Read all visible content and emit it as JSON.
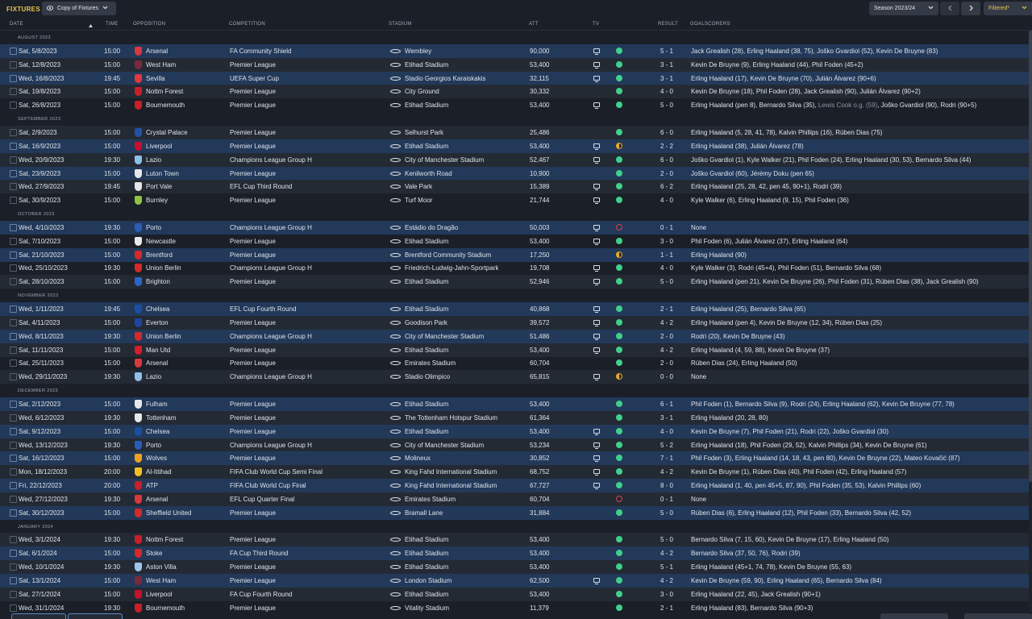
{
  "header": {
    "title": "FIXTURES",
    "view_label": "Copy of Fixtures",
    "season_label": "Season 2023/24",
    "filter_label": "Filtered*"
  },
  "columns": {
    "date": "DATE",
    "time": "TIME",
    "opposition": "OPPOSITION",
    "competition": "COMPETITION",
    "stadium": "STADIUM",
    "attendance": "ATT",
    "tv": "TV",
    "result": "RESULT",
    "goalscorers": "GOALSCORERS"
  },
  "rows": [
    {
      "month": "AUGUST 2023"
    },
    {
      "date": "Sat, 5/8/2023",
      "time": "15:00",
      "opp": "Arsenal",
      "crest": "#d8383e",
      "comp": "FA Community Shield",
      "stadium": "Wembley",
      "att": "90,000",
      "tv": true,
      "outcome": "win",
      "result": "5 - 1",
      "goals": "Jack Grealish (28), Erling Haaland (38, 75), Joško Gvardiol (52), Kevin De Bruyne (83)"
    },
    {
      "date": "Sat, 12/8/2023",
      "time": "15:00",
      "opp": "West Ham",
      "crest": "#7a2a3c",
      "comp": "Premier League",
      "stadium": "Etihad Stadium",
      "att": "53,400",
      "tv": true,
      "outcome": "win",
      "result": "3 - 1",
      "goals": "Kevin De Bruyne (9), Erling Haaland (44), Phil Foden (45+2)"
    },
    {
      "date": "Wed, 16/8/2023",
      "time": "19:45",
      "opp": "Sevilla",
      "crest": "#e03a3e",
      "comp": "UEFA Super Cup",
      "stadium": "Stadio Georgios Karaiskakis",
      "att": "32,115",
      "tv": true,
      "outcome": "win",
      "result": "3 - 1",
      "goals": "Erling Haaland (17), Kevin De Bruyne (70), Julián Álvarez (90+6)"
    },
    {
      "date": "Sat, 19/8/2023",
      "time": "15:00",
      "opp": "Nottm Forest",
      "crest": "#c8202a",
      "comp": "Premier League",
      "stadium": "City Ground",
      "att": "30,332",
      "tv": false,
      "outcome": "win",
      "result": "4 - 0",
      "goals": "Kevin De Bruyne (18), Phil Foden (28), Jack Grealish (90), Julián Álvarez (90+2)"
    },
    {
      "date": "Sat, 26/8/2023",
      "time": "15:00",
      "opp": "Bournemouth",
      "crest": "#c8202a",
      "comp": "Premier League",
      "stadium": "Etihad Stadium",
      "att": "53,400",
      "tv": true,
      "outcome": "win",
      "result": "5 - 0",
      "goals": "Erling Haaland (pen 8), Bernardo Silva (35), ",
      "og": "Lewis Cook o.g. (59)",
      "goals_after": ", Joško Gvardiol (90), Rodri (90+5)"
    },
    {
      "month": "SEPTEMBER 2023"
    },
    {
      "date": "Sat, 2/9/2023",
      "time": "15:00",
      "opp": "Crystal Palace",
      "crest": "#2350a8",
      "comp": "Premier League",
      "stadium": "Selhurst Park",
      "att": "25,486",
      "tv": false,
      "outcome": "win",
      "result": "6 - 0",
      "goals": "Erling Haaland (5, 28, 41, 78), Kalvin Phillips (16), Rúben Dias (75)"
    },
    {
      "date": "Sat, 16/9/2023",
      "time": "15:00",
      "opp": "Liverpool",
      "crest": "#c8102e",
      "comp": "Premier League",
      "stadium": "Etihad Stadium",
      "att": "53,400",
      "tv": true,
      "outcome": "draw",
      "result": "2 - 2",
      "goals": "Erling Haaland (38), Julián Álvarez (78)"
    },
    {
      "date": "Wed, 20/9/2023",
      "time": "19:30",
      "opp": "Lazio",
      "crest": "#8fc1e8",
      "comp": "Champions League Group H",
      "stadium": "City of Manchester Stadium",
      "att": "52,467",
      "tv": true,
      "outcome": "win",
      "result": "6 - 0",
      "goals": "Joško Gvardiol (1), Kyle Walker (21), Phil Foden (24), Erling Haaland (30, 53), Bernardo Silva (44)"
    },
    {
      "date": "Sat, 23/9/2023",
      "time": "15:00",
      "opp": "Luton Town",
      "crest": "#e8e8e8",
      "comp": "Premier League",
      "stadium": "Kenilworth Road",
      "att": "10,900",
      "tv": false,
      "outcome": "win",
      "result": "2 - 0",
      "goals": "Joško Gvardiol (60), Jérémy Doku (pen 65)"
    },
    {
      "date": "Wed, 27/9/2023",
      "time": "19:45",
      "opp": "Port Vale",
      "crest": "#e6e6e6",
      "comp": "EFL Cup Third Round",
      "stadium": "Vale Park",
      "att": "15,389",
      "tv": true,
      "outcome": "win",
      "result": "6 - 2",
      "goals": "Erling Haaland (25, 28, 42, pen 45, 90+1), Rodri (39)"
    },
    {
      "date": "Sat, 30/9/2023",
      "time": "15:00",
      "opp": "Burnley",
      "crest": "#8fc43f",
      "comp": "Premier League",
      "stadium": "Turf Moor",
      "att": "21,744",
      "tv": true,
      "outcome": "win",
      "result": "4 - 0",
      "goals": "Kyle Walker (6), Erling Haaland (9, 15), Phil Foden (36)"
    },
    {
      "month": "OCTOBER 2023"
    },
    {
      "date": "Wed, 4/10/2023",
      "time": "19:30",
      "opp": "Porto",
      "crest": "#2b5cb8",
      "comp": "Champions League Group H",
      "stadium": "Estádio do Dragão",
      "att": "50,003",
      "tv": true,
      "outcome": "loss",
      "result": "0 - 1",
      "goals": "None"
    },
    {
      "date": "Sat, 7/10/2023",
      "time": "15:00",
      "opp": "Newcastle",
      "crest": "#e8e8e8",
      "comp": "Premier League",
      "stadium": "Etihad Stadium",
      "att": "53,400",
      "tv": true,
      "outcome": "win",
      "result": "3 - 0",
      "goals": "Phil Foden (6), Julián Álvarez (37), Erling Haaland (64)"
    },
    {
      "date": "Sat, 21/10/2023",
      "time": "15:00",
      "opp": "Brentford",
      "crest": "#d42a2a",
      "comp": "Premier League",
      "stadium": "Brentford Community Stadium",
      "att": "17,250",
      "tv": false,
      "outcome": "draw",
      "result": "1 - 1",
      "goals": "Erling Haaland (90)"
    },
    {
      "date": "Wed, 25/10/2023",
      "time": "19:30",
      "opp": "Union Berlin",
      "crest": "#d42a2a",
      "comp": "Champions League Group H",
      "stadium": "Friedrich-Ludwig-Jahn-Sportpark",
      "att": "19,708",
      "tv": true,
      "outcome": "win",
      "result": "4 - 0",
      "goals": "Kyle Walker (3), Rodri (45+4), Phil Foden (51), Bernardo Silva (68)"
    },
    {
      "date": "Sat, 28/10/2023",
      "time": "15:00",
      "opp": "Brighton",
      "crest": "#2a67c4",
      "comp": "Premier League",
      "stadium": "Etihad Stadium",
      "att": "52,946",
      "tv": true,
      "outcome": "win",
      "result": "5 - 0",
      "goals": "Erling Haaland (pen 21), Kevin De Bruyne (26), Phil Foden (31), Rúben Dias (38), Jack Grealish (90)"
    },
    {
      "month": "NOVEMBER 2023"
    },
    {
      "date": "Wed, 1/11/2023",
      "time": "19:45",
      "opp": "Chelsea",
      "crest": "#1c4fa0",
      "comp": "EFL Cup Fourth Round",
      "stadium": "Etihad Stadium",
      "att": "40,868",
      "tv": true,
      "outcome": "win",
      "result": "2 - 1",
      "goals": "Erling Haaland (25), Bernardo Silva (65)"
    },
    {
      "date": "Sat, 4/11/2023",
      "time": "15:00",
      "opp": "Everton",
      "crest": "#1d46a0",
      "comp": "Premier League",
      "stadium": "Goodison Park",
      "att": "39,572",
      "tv": true,
      "outcome": "win",
      "result": "4 - 2",
      "goals": "Erling Haaland (pen 4), Kevin De Bruyne (12, 34), Rúben Dias (25)"
    },
    {
      "date": "Wed, 8/11/2023",
      "time": "19:30",
      "opp": "Union Berlin",
      "crest": "#d42a2a",
      "comp": "Champions League Group H",
      "stadium": "City of Manchester Stadium",
      "att": "51,486",
      "tv": true,
      "outcome": "win",
      "result": "2 - 0",
      "goals": "Rodri (20), Kevin De Bruyne (43)"
    },
    {
      "date": "Sat, 11/11/2023",
      "time": "15:00",
      "opp": "Man Utd",
      "crest": "#d41e2a",
      "comp": "Premier League",
      "stadium": "Etihad Stadium",
      "att": "53,400",
      "tv": true,
      "outcome": "win",
      "result": "4 - 2",
      "goals": "Erling Haaland (4, 59, 88), Kevin De Bruyne (37)"
    },
    {
      "date": "Sat, 25/11/2023",
      "time": "15:00",
      "opp": "Arsenal",
      "crest": "#d8383e",
      "comp": "Premier League",
      "stadium": "Emirates Stadium",
      "att": "60,704",
      "tv": false,
      "outcome": "win",
      "result": "2 - 0",
      "goals": "Rúben Dias (24), Erling Haaland (50)"
    },
    {
      "date": "Wed, 29/11/2023",
      "time": "19:30",
      "opp": "Lazio",
      "crest": "#8fc1e8",
      "comp": "Champions League Group H",
      "stadium": "Stadio Olimpico",
      "att": "65,815",
      "tv": true,
      "outcome": "draw",
      "result": "0 - 0",
      "goals": "None"
    },
    {
      "month": "DECEMBER 2023"
    },
    {
      "date": "Sat, 2/12/2023",
      "time": "15:00",
      "opp": "Fulham",
      "crest": "#e8e8e8",
      "comp": "Premier League",
      "stadium": "Etihad Stadium",
      "att": "53,400",
      "tv": false,
      "outcome": "win",
      "result": "6 - 1",
      "goals": "Phil Foden (1), Bernardo Silva (9), Rodri (24), Erling Haaland (62), Kevin De Bruyne (77, 78)"
    },
    {
      "date": "Wed, 6/12/2023",
      "time": "19:30",
      "opp": "Tottenham",
      "crest": "#e8e8e8",
      "comp": "Premier League",
      "stadium": "The Tottenham Hotspur Stadium",
      "att": "61,364",
      "tv": false,
      "outcome": "win",
      "result": "3 - 1",
      "goals": "Erling Haaland (20, 28, 80)"
    },
    {
      "date": "Sat, 9/12/2023",
      "time": "15:00",
      "opp": "Chelsea",
      "crest": "#1c4fa0",
      "comp": "Premier League",
      "stadium": "Etihad Stadium",
      "att": "53,400",
      "tv": true,
      "outcome": "win",
      "result": "4 - 0",
      "goals": "Kevin De Bruyne (7), Phil Foden (21), Rodri (22), Joško Gvardiol (30)"
    },
    {
      "date": "Wed, 13/12/2023",
      "time": "19:30",
      "opp": "Porto",
      "crest": "#2b5cb8",
      "comp": "Champions League Group H",
      "stadium": "City of Manchester Stadium",
      "att": "53,234",
      "tv": true,
      "outcome": "win",
      "result": "5 - 2",
      "goals": "Erling Haaland (18), Phil Foden (29, 52), Kalvin Phillips (34), Kevin De Bruyne (61)"
    },
    {
      "date": "Sat, 16/12/2023",
      "time": "15:00",
      "opp": "Wolves",
      "crest": "#f0a020",
      "comp": "Premier League",
      "stadium": "Molineux",
      "att": "30,852",
      "tv": true,
      "outcome": "win",
      "result": "7 - 1",
      "goals": "Phil Foden (3), Erling Haaland (14, 18, 43, pen 80), Kevin De Bruyne (22), Mateo Kovačić (87)"
    },
    {
      "date": "Mon, 18/12/2023",
      "time": "20:00",
      "opp": "Al-Ittihad",
      "crest": "#f0c020",
      "comp": "FIFA Club World Cup Semi Final",
      "stadium": "King Fahd International Stadium",
      "att": "68,752",
      "tv": true,
      "outcome": "win",
      "result": "4 - 2",
      "goals": "Kevin De Bruyne (1), Rúben Dias (40), Phil Foden (42), Erling Haaland (57)"
    },
    {
      "date": "Fri, 22/12/2023",
      "time": "20:00",
      "opp": "ATP",
      "crest": "#c8202a",
      "comp": "FIFA Club World Cup Final",
      "stadium": "King Fahd International Stadium",
      "att": "67,727",
      "tv": true,
      "outcome": "win",
      "result": "8 - 0",
      "goals": "Erling Haaland (1, 40, pen 45+5, 87, 90), Phil Foden (35, 53), Kalvin Phillips (60)"
    },
    {
      "date": "Wed, 27/12/2023",
      "time": "19:30",
      "opp": "Arsenal",
      "crest": "#d8383e",
      "comp": "EFL Cup Quarter Final",
      "stadium": "Emirates Stadium",
      "att": "60,704",
      "tv": false,
      "outcome": "loss",
      "result": "0 - 1",
      "goals": "None"
    },
    {
      "date": "Sat, 30/12/2023",
      "time": "15:00",
      "opp": "Sheffield United",
      "crest": "#d42a2a",
      "comp": "Premier League",
      "stadium": "Bramall Lane",
      "att": "31,884",
      "tv": false,
      "outcome": "win",
      "result": "5 - 0",
      "goals": "Rúben Dias (6), Erling Haaland (12), Phil Foden (33), Bernardo Silva (42, 52)"
    },
    {
      "month": "JANUARY 2024"
    },
    {
      "date": "Wed, 3/1/2024",
      "time": "19:30",
      "opp": "Nottm Forest",
      "crest": "#c8202a",
      "comp": "Premier League",
      "stadium": "Etihad Stadium",
      "att": "53,400",
      "tv": false,
      "outcome": "win",
      "result": "5 - 0",
      "goals": "Bernardo Silva (7, 15, 60), Kevin De Bruyne (17), Erling Haaland (50)"
    },
    {
      "date": "Sat, 6/1/2024",
      "time": "15:00",
      "opp": "Stoke",
      "crest": "#d42a2a",
      "comp": "FA Cup Third Round",
      "stadium": "Etihad Stadium",
      "att": "53,400",
      "tv": false,
      "outcome": "win",
      "result": "4 - 2",
      "goals": "Bernardo Silva (37, 50, 76), Rodri (39)"
    },
    {
      "date": "Wed, 10/1/2024",
      "time": "19:30",
      "opp": "Aston Villa",
      "crest": "#9ec6ea",
      "comp": "Premier League",
      "stadium": "Etihad Stadium",
      "att": "53,400",
      "tv": false,
      "outcome": "win",
      "result": "5 - 1",
      "goals": "Erling Haaland (45+1, 74, 78), Kevin De Bruyne (55, 63)"
    },
    {
      "date": "Sat, 13/1/2024",
      "time": "15:00",
      "opp": "West Ham",
      "crest": "#7a2a3c",
      "comp": "Premier League",
      "stadium": "London Stadium",
      "att": "62,500",
      "tv": true,
      "outcome": "win",
      "result": "4 - 2",
      "goals": "Kevin De Bruyne (59, 90), Erling Haaland (65), Bernardo Silva (84)"
    },
    {
      "date": "Sat, 27/1/2024",
      "time": "15:00",
      "opp": "Liverpool",
      "crest": "#c8102e",
      "comp": "FA Cup Fourth Round",
      "stadium": "Etihad Stadium",
      "att": "53,400",
      "tv": false,
      "outcome": "win",
      "result": "3 - 0",
      "goals": "Erling Haaland (22, 45), Jack Grealish (90+1)"
    },
    {
      "date": "Wed, 31/1/2024",
      "time": "19:30",
      "opp": "Bournemouth",
      "crest": "#c8202a",
      "comp": "Premier League",
      "stadium": "Vitality Stadium",
      "att": "11,379",
      "tv": false,
      "outcome": "win",
      "result": "2 - 1",
      "goals": "Erling Haaland (83), Bernardo Silva (90+3)"
    }
  ],
  "colors": {
    "accent": "#e7c54f",
    "win": "#3fd08a",
    "loss": "#d9444f",
    "draw": "#e5a92c",
    "highlight": "#22395a"
  }
}
